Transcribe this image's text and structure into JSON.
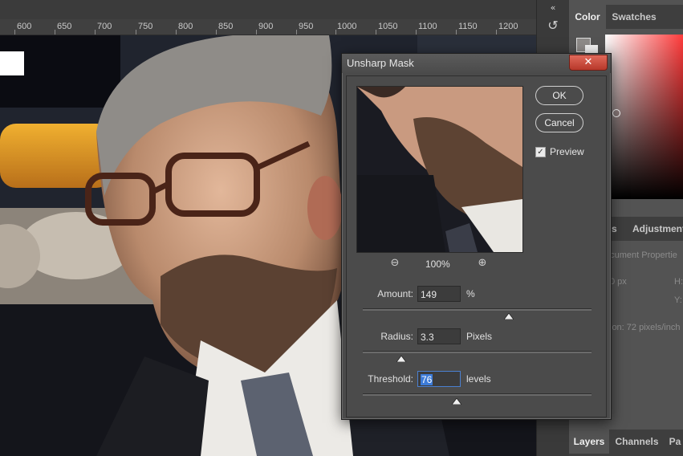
{
  "ruler": {
    "labels": [
      "600",
      "650",
      "700",
      "750",
      "800",
      "850",
      "900",
      "950",
      "1000",
      "1050",
      "1100",
      "1150",
      "1200"
    ]
  },
  "panels": {
    "top_tabs": [
      "Color",
      "Swatches"
    ],
    "mid_tabs": [
      "es",
      "Adjustment"
    ],
    "mid_lines": [
      "ocument Propertie",
      "0 px",
      "H:",
      "Y:",
      "ion: 72 pixels/inch"
    ],
    "bottom_tabs": [
      "Layers",
      "Channels",
      "Pa"
    ]
  },
  "dialog": {
    "title": "Unsharp Mask",
    "close_glyph": "✕",
    "ok_label": "OK",
    "cancel_label": "Cancel",
    "preview_label": "Preview",
    "preview_checked": true,
    "zoom_level": "100%",
    "amount": {
      "label": "Amount:",
      "value": "149",
      "unit": "%",
      "slider": 0.64
    },
    "radius": {
      "label": "Radius:",
      "value": "3.3",
      "unit": "Pixels",
      "slider": 0.17
    },
    "threshold": {
      "label": "Threshold:",
      "value": "76",
      "unit": "levels",
      "slider": 0.41
    }
  },
  "colors": {
    "dialog_bg": "#4a4a4a",
    "close_red": "#c9463a",
    "selection_blue": "#3c7bd8"
  },
  "icons": [
    "zoom-out-icon",
    "zoom-in-icon",
    "checkbox-check-icon",
    "close-icon",
    "rotate-history-icon",
    "collapse-arrows-icon"
  ]
}
